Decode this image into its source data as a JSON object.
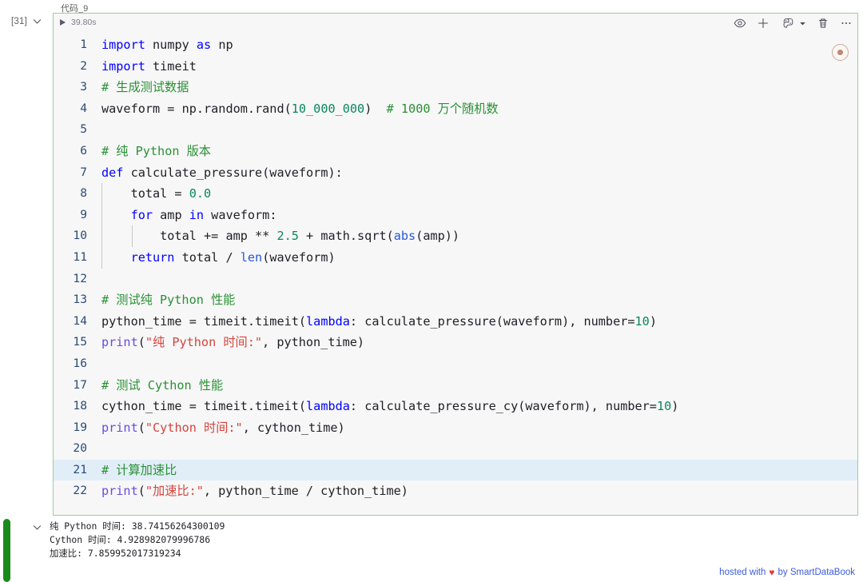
{
  "cell": {
    "title": "代码_9",
    "execution_count": "[31]",
    "timing": "39.80s",
    "collapse_icon": "chevron-down-icon",
    "run_icon": "play-triangle-icon",
    "status": "success",
    "status_color": "#1a8a1a",
    "toolbar": [
      {
        "name": "eye-icon",
        "label": "查看"
      },
      {
        "name": "plus-icon",
        "label": "添加"
      },
      {
        "name": "python-kernel-icon",
        "label": "内核"
      },
      {
        "name": "trash-icon",
        "label": "删除"
      },
      {
        "name": "more-icon",
        "label": "更多"
      }
    ],
    "kernel_badge": "python-kernel-badge"
  },
  "editor": {
    "highlighted_line": 21,
    "lines": [
      {
        "n": 1,
        "guides": 0,
        "tokens": [
          {
            "t": "import",
            "c": "kw"
          },
          {
            "t": " ",
            "c": "pl"
          },
          {
            "t": "numpy",
            "c": "pl"
          },
          {
            "t": " ",
            "c": "pl"
          },
          {
            "t": "as",
            "c": "kw"
          },
          {
            "t": " ",
            "c": "pl"
          },
          {
            "t": "np",
            "c": "pl"
          }
        ]
      },
      {
        "n": 2,
        "guides": 0,
        "tokens": [
          {
            "t": "import",
            "c": "kw"
          },
          {
            "t": " timeit",
            "c": "pl"
          }
        ]
      },
      {
        "n": 3,
        "guides": 0,
        "tokens": [
          {
            "t": "# 生成测试数据",
            "c": "cm"
          }
        ]
      },
      {
        "n": 4,
        "guides": 0,
        "tokens": [
          {
            "t": "waveform = np.random.rand(",
            "c": "pl"
          },
          {
            "t": "10_000_000",
            "c": "num"
          },
          {
            "t": ")  ",
            "c": "pl"
          },
          {
            "t": "# 1000 万个随机数",
            "c": "cm"
          }
        ]
      },
      {
        "n": 5,
        "guides": 0,
        "tokens": []
      },
      {
        "n": 6,
        "guides": 0,
        "tokens": [
          {
            "t": "# 纯 Python 版本",
            "c": "cm"
          }
        ]
      },
      {
        "n": 7,
        "guides": 0,
        "tokens": [
          {
            "t": "def",
            "c": "kw"
          },
          {
            "t": " calculate_pressure(waveform):",
            "c": "pl"
          }
        ]
      },
      {
        "n": 8,
        "guides": 1,
        "tokens": [
          {
            "t": "    total = ",
            "c": "pl"
          },
          {
            "t": "0.0",
            "c": "num"
          }
        ]
      },
      {
        "n": 9,
        "guides": 1,
        "tokens": [
          {
            "t": "    ",
            "c": "pl"
          },
          {
            "t": "for",
            "c": "kw"
          },
          {
            "t": " amp ",
            "c": "pl"
          },
          {
            "t": "in",
            "c": "kw"
          },
          {
            "t": " waveform:",
            "c": "pl"
          }
        ]
      },
      {
        "n": 10,
        "guides": 2,
        "tokens": [
          {
            "t": "        total += amp ** ",
            "c": "pl"
          },
          {
            "t": "2.5",
            "c": "num"
          },
          {
            "t": " + math.sqrt(",
            "c": "pl"
          },
          {
            "t": "abs",
            "c": "bi"
          },
          {
            "t": "(amp))",
            "c": "pl"
          }
        ]
      },
      {
        "n": 11,
        "guides": 1,
        "tokens": [
          {
            "t": "    ",
            "c": "pl"
          },
          {
            "t": "return",
            "c": "kw"
          },
          {
            "t": " total / ",
            "c": "pl"
          },
          {
            "t": "len",
            "c": "bi"
          },
          {
            "t": "(waveform)",
            "c": "pl"
          }
        ]
      },
      {
        "n": 12,
        "guides": 0,
        "tokens": []
      },
      {
        "n": 13,
        "guides": 0,
        "tokens": [
          {
            "t": "# 测试纯 Python 性能",
            "c": "cm"
          }
        ]
      },
      {
        "n": 14,
        "guides": 0,
        "tokens": [
          {
            "t": "python_time = timeit.timeit(",
            "c": "pl"
          },
          {
            "t": "lambda",
            "c": "kw"
          },
          {
            "t": ": calculate_pressure(waveform), number=",
            "c": "pl"
          },
          {
            "t": "10",
            "c": "num"
          },
          {
            "t": ")",
            "c": "pl"
          }
        ]
      },
      {
        "n": 15,
        "guides": 0,
        "tokens": [
          {
            "t": "print",
            "c": "fn"
          },
          {
            "t": "(",
            "c": "pl"
          },
          {
            "t": "\"纯 Python 时间:\"",
            "c": "str"
          },
          {
            "t": ", python_time)",
            "c": "pl"
          }
        ]
      },
      {
        "n": 16,
        "guides": 0,
        "tokens": []
      },
      {
        "n": 17,
        "guides": 0,
        "tokens": [
          {
            "t": "# 测试 Cython 性能",
            "c": "cm"
          }
        ]
      },
      {
        "n": 18,
        "guides": 0,
        "tokens": [
          {
            "t": "cython_time = timeit.timeit(",
            "c": "pl"
          },
          {
            "t": "lambda",
            "c": "kw"
          },
          {
            "t": ": calculate_pressure_cy(waveform), number=",
            "c": "pl"
          },
          {
            "t": "10",
            "c": "num"
          },
          {
            "t": ")",
            "c": "pl"
          }
        ]
      },
      {
        "n": 19,
        "guides": 0,
        "tokens": [
          {
            "t": "print",
            "c": "fn"
          },
          {
            "t": "(",
            "c": "pl"
          },
          {
            "t": "\"Cython 时间:\"",
            "c": "str"
          },
          {
            "t": ", cython_time)",
            "c": "pl"
          }
        ]
      },
      {
        "n": 20,
        "guides": 0,
        "tokens": []
      },
      {
        "n": 21,
        "guides": 0,
        "tokens": [
          {
            "t": "# 计算加速比",
            "c": "cm"
          }
        ]
      },
      {
        "n": 22,
        "guides": 0,
        "tokens": [
          {
            "t": "print",
            "c": "fn"
          },
          {
            "t": "(",
            "c": "pl"
          },
          {
            "t": "\"加速比:\"",
            "c": "str"
          },
          {
            "t": ", python_time / cython_time)",
            "c": "pl"
          }
        ]
      }
    ]
  },
  "output": {
    "collapse_icon": "chevron-down-icon",
    "lines": [
      "纯 Python 时间: 38.74156264300109",
      "Cython 时间: 4.928982079996786",
      "加速比: 7.859952017319234"
    ]
  },
  "footer": {
    "prefix": "hosted with",
    "heart": "♥",
    "suffix": "by SmartDataBook"
  }
}
